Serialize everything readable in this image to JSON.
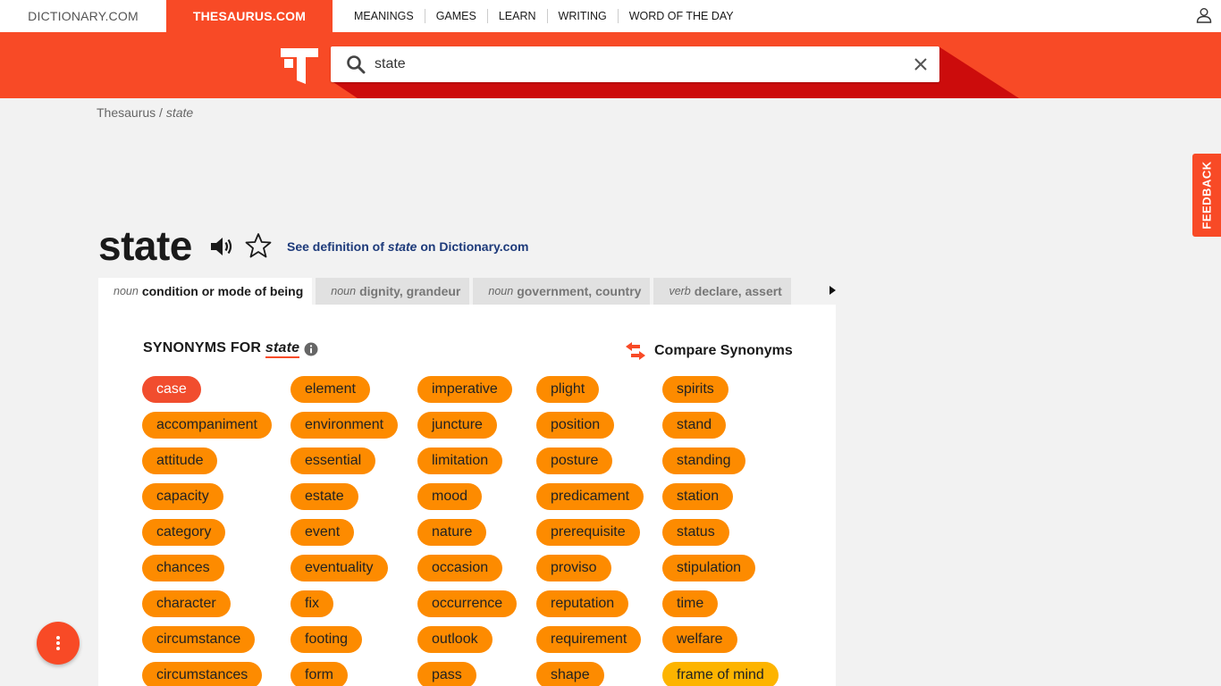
{
  "topnav": {
    "dictionary_tab": "DICTIONARY.COM",
    "thesaurus_tab": "THESAURUS.COM",
    "links": [
      "MEANINGS",
      "GAMES",
      "LEARN",
      "WRITING",
      "WORD OF THE DAY"
    ]
  },
  "search": {
    "value": "state"
  },
  "breadcrumb": {
    "root": "Thesaurus",
    "separator": "/",
    "current": "state"
  },
  "feedback_label": "FEEDBACK",
  "entry": {
    "headword": "state",
    "definition_link": {
      "prefix": "See definition of",
      "word": "state",
      "suffix": "on Dictionary.com"
    }
  },
  "sense_tabs": [
    {
      "pos": "noun",
      "label": "condition or mode of being",
      "active": true
    },
    {
      "pos": "noun",
      "label": "dignity, grandeur",
      "active": false
    },
    {
      "pos": "noun",
      "label": "government, country",
      "active": false
    },
    {
      "pos": "verb",
      "label": "declare, assert",
      "active": false
    }
  ],
  "synonyms": {
    "title_prefix": "SYNONYMS FOR",
    "title_word": "state",
    "compare_label": "Compare Synonyms",
    "columns": [
      [
        "case",
        "accompaniment",
        "attitude",
        "capacity",
        "category",
        "chances",
        "character",
        "circumstance",
        "circumstances"
      ],
      [
        "element",
        "environment",
        "essential",
        "estate",
        "event",
        "eventuality",
        "fix",
        "footing",
        "form"
      ],
      [
        "imperative",
        "juncture",
        "limitation",
        "mood",
        "nature",
        "occasion",
        "occurrence",
        "outlook",
        "pass"
      ],
      [
        "plight",
        "position",
        "posture",
        "predicament",
        "prerequisite",
        "proviso",
        "reputation",
        "requirement",
        "shape"
      ],
      [
        "spirits",
        "stand",
        "standing",
        "station",
        "status",
        "stipulation",
        "time",
        "welfare",
        "frame of mind"
      ]
    ],
    "strongest": "case",
    "weaker": [
      "frame of mind"
    ]
  },
  "colors": {
    "brand_orange": "#f84a26",
    "pill_orange": "#fd8b00",
    "pill_strong": "#f14d2e",
    "pill_weak": "#fdb400",
    "link_blue": "#1d3a7a"
  },
  "icons": [
    "user-icon",
    "thesaurus-logo-icon",
    "search-icon",
    "clear-icon",
    "speaker-icon",
    "star-icon",
    "info-icon",
    "compare-arrows-icon",
    "caret-right-icon",
    "kebab-menu-icon"
  ]
}
